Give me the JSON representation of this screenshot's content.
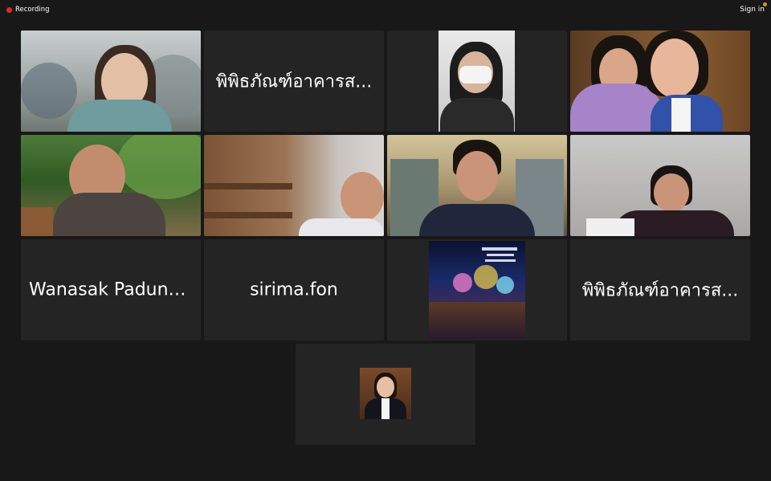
{
  "recording": {
    "label": "Recording"
  },
  "header": {
    "signin_label": "Sign in"
  },
  "participants": [
    {
      "name": "",
      "has_video": true
    },
    {
      "name": "พิพิธภัณฑ์อาคารส...",
      "has_video": false
    },
    {
      "name": "",
      "has_video": true
    },
    {
      "name": "",
      "has_video": true
    },
    {
      "name": "",
      "has_video": true
    },
    {
      "name": "",
      "has_video": true
    },
    {
      "name": "",
      "has_video": true
    },
    {
      "name": "",
      "has_video": true
    },
    {
      "name": "Wanasak Padungs...",
      "has_video": false
    },
    {
      "name": "sirima.fon",
      "has_video": false
    },
    {
      "name": "",
      "has_video": true
    },
    {
      "name": "พิพิธภัณฑ์อาคารส...",
      "has_video": false
    },
    {
      "name": "",
      "has_video": true
    }
  ],
  "colors": {
    "active_speaker": "#3ec73e",
    "recording": "#e02828",
    "tile_bg": "#242424",
    "app_bg": "#181818"
  }
}
